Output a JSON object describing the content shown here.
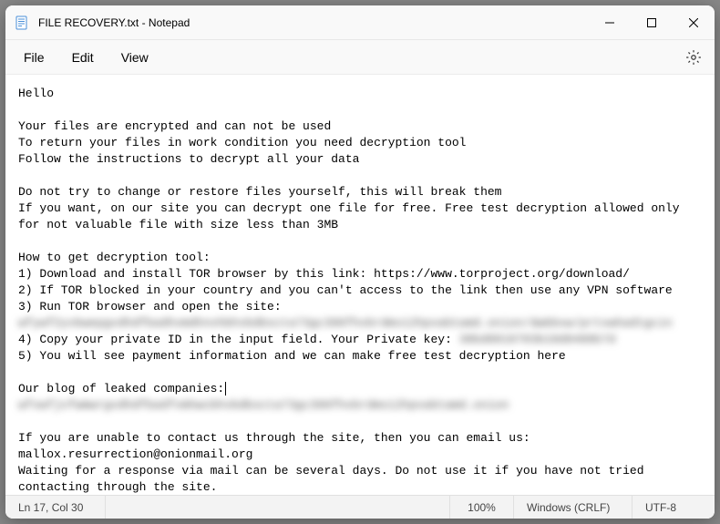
{
  "titlebar": {
    "title": "FILE RECOVERY.txt - Notepad"
  },
  "menu": {
    "file": "File",
    "edit": "Edit",
    "view": "View"
  },
  "content": {
    "l1": "Hello",
    "l2": "Your files are encrypted and can not be used",
    "l3": "To return your files in work condition you need decryption tool",
    "l4": "Follow the instructions to decrypt all your data",
    "l5": "Do not try to change or restore files yourself, this will break them",
    "l6": "If you want, on our site you can decrypt one file for free. Free test decryption allowed only for not valuable file with size less than 3MB",
    "l7": "How to get decryption tool:",
    "l8": "1) Download and install TOR browser by this link: https://www.torproject.org/download/",
    "l9": "2) If TOR blocked in your country and you can't access to the link then use any VPN software",
    "l10": "3) Run TOR browser and open the site:",
    "blurred1": "wfywf2yvbwepgvdhdfbadhvmdhnvhbhvbdbscta73gc396fhvbrdms12hpvabtamd.onion/dwbbvw/prtvwhadtgcin",
    "l11": "4) Copy your private ID in the input field. Your Private key: ",
    "blurred2": "38bd8818783b18d8488b7d",
    "l12": "5) You will see payment information and we can make free test decryption here",
    "l13": "Our blog of leaked companies:",
    "blurred3": "wfvwfjvfwmwrgvdhdfbadfvmhwcbhvbdbscta73gc396fhvbrdms12hpvabtamd.onion",
    "l14": "If you are unable to contact us through the site, then you can email us:",
    "l15": "mallox.resurrection@onionmail.org",
    "l16": "Waiting for a response via mail can be several days. Do not use it if you have not tried contacting through the site."
  },
  "statusbar": {
    "position": "Ln 17, Col 30",
    "zoom": "100%",
    "eol": "Windows (CRLF)",
    "encoding": "UTF-8"
  }
}
